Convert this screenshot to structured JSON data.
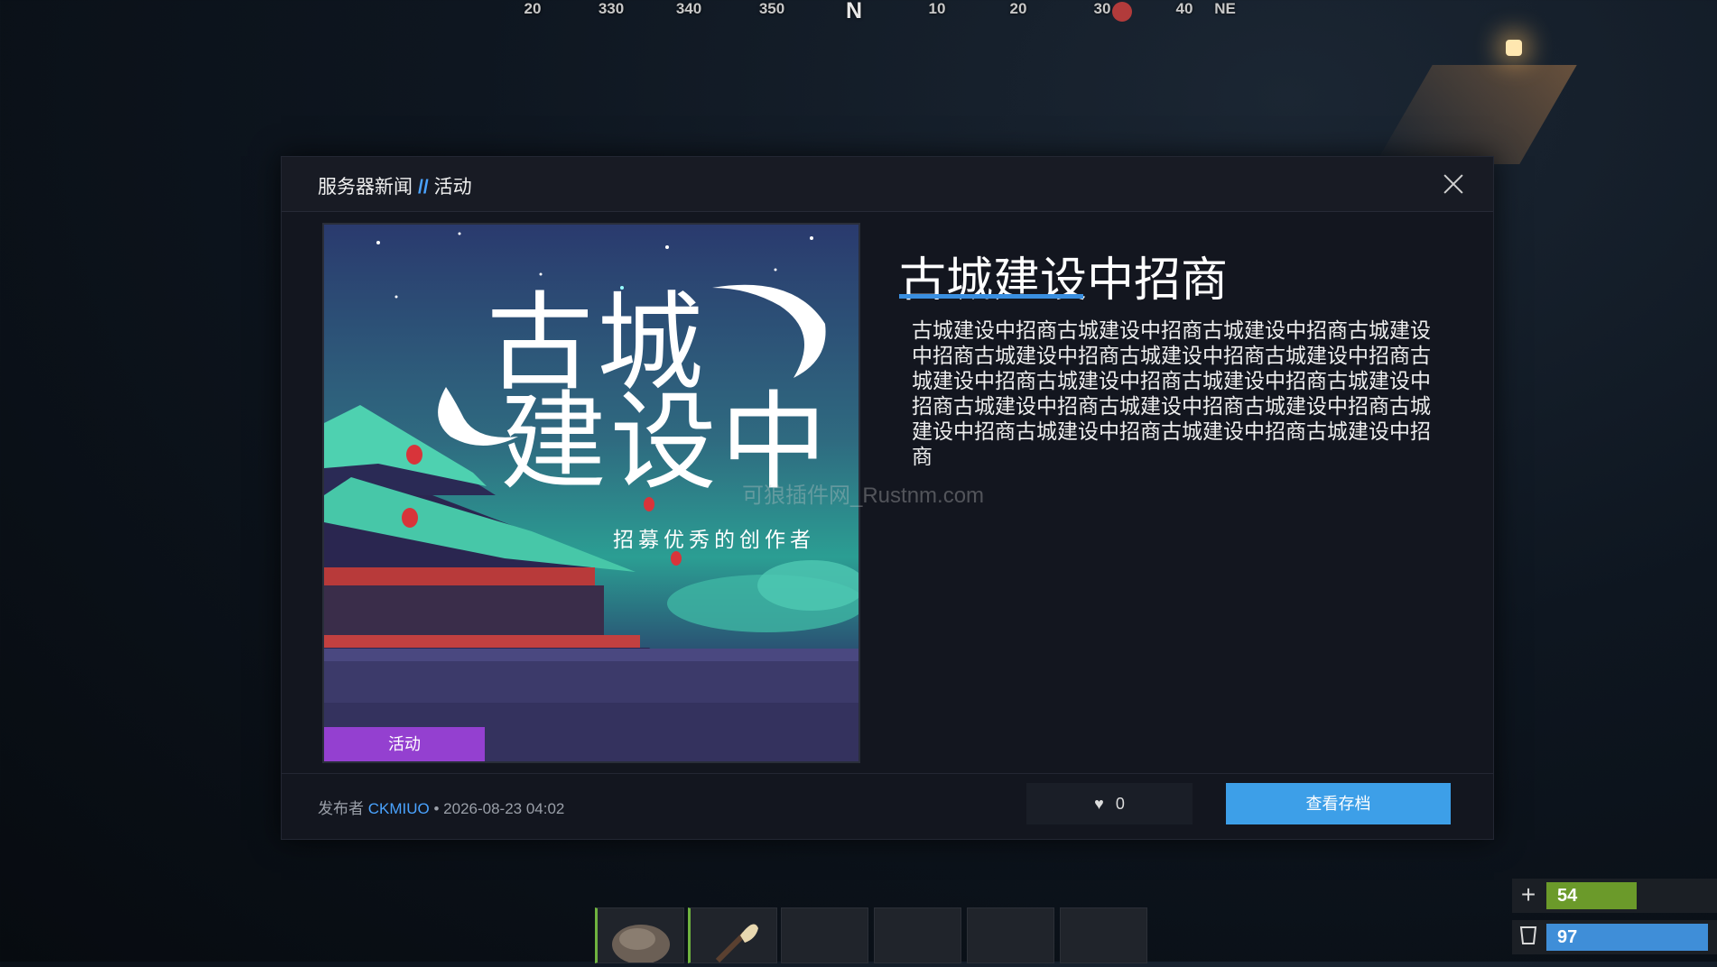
{
  "compass": {
    "ticks": [
      "20",
      "330",
      "340",
      "350",
      "N",
      "10",
      "20",
      "30",
      "40",
      "NE"
    ]
  },
  "modal": {
    "breadcrumb": {
      "section": "服务器新闻",
      "separator": "//",
      "category": "活动"
    },
    "banner": {
      "title_line_1": "古城",
      "title_line_2": "建设中",
      "subtitle": "招募优秀的创作者",
      "tag": "活动"
    },
    "article": {
      "title": "古城建设中招商",
      "body": "古城建设中招商古城建设中招商古城建设中招商古城建设中招商古城建设中招商古城建设中招商古城建设中招商古城建设中招商古城建设中招商古城建设中招商古城建设中招商古城建设中招商古城建设中招商古城建设中招商古城建设中招商古城建设中招商古城建设中招商古城建设中招商"
    },
    "watermark": "可狼插件网_Rustnm.com",
    "footer": {
      "publisher_label": "发布者",
      "author": "CKMIUO",
      "dot": "•",
      "date": "2026-08-23 04:02",
      "like_icon": "♥",
      "likes": "0",
      "view_button": "查看存档"
    }
  },
  "status": {
    "health": {
      "icon": "plus-icon",
      "value": "54",
      "fraction": 0.54,
      "color": "#6b9a2a"
    },
    "water": {
      "icon": "cup-icon",
      "value": "97",
      "fraction": 0.97,
      "color": "#3f8ed8"
    }
  },
  "colors": {
    "accent": "#3d9fe8",
    "tag": "#9440d0"
  }
}
